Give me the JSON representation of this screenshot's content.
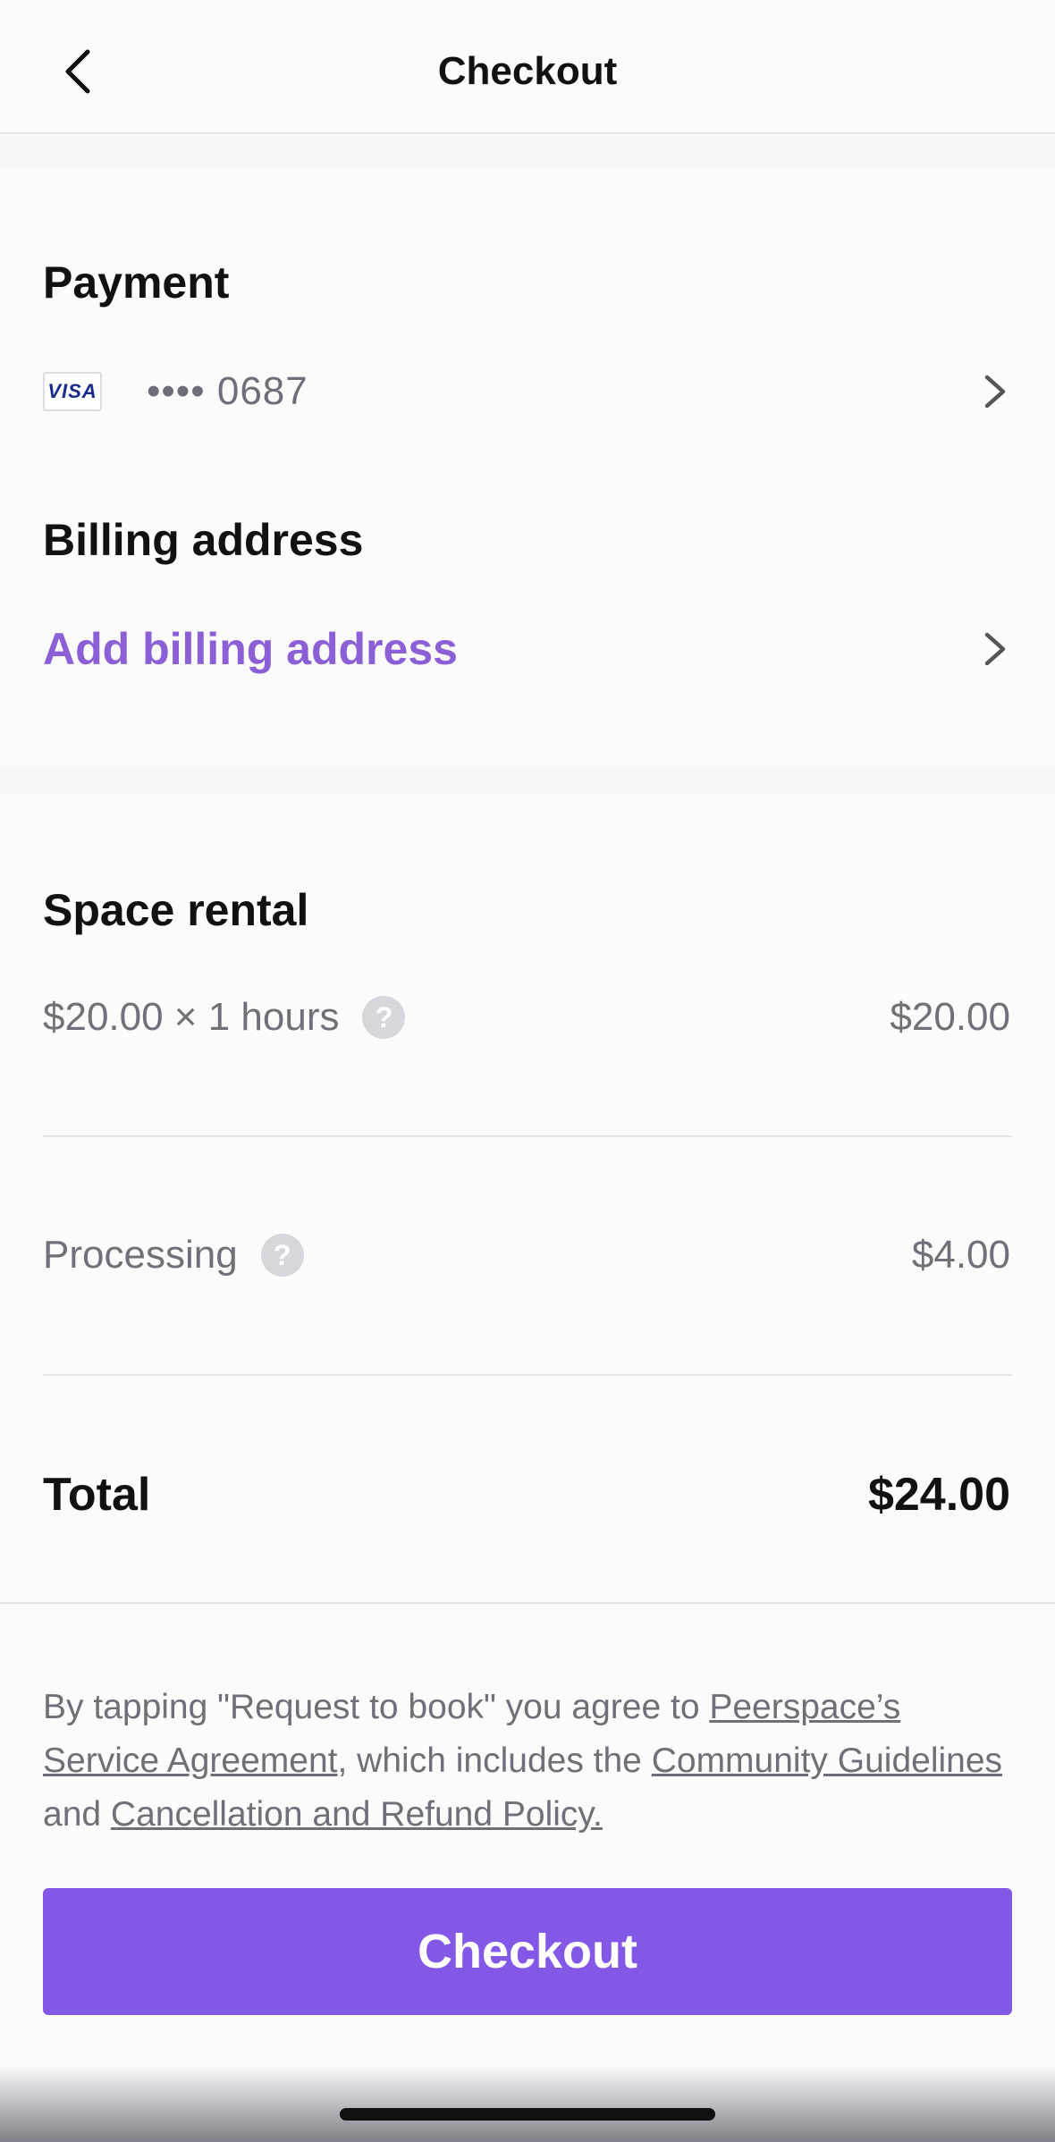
{
  "header": {
    "title": "Checkout",
    "back_icon": "chevron-left-icon"
  },
  "payment": {
    "section_title": "Payment",
    "card_brand": "VISA",
    "card_number": "•••• 0687"
  },
  "billing": {
    "section_title": "Billing address",
    "add_label": "Add billing address",
    "link_color": "#8b5fd6"
  },
  "pricing": {
    "section_title": "Space rental",
    "rental_label": "$20.00 × 1 hours",
    "rental_value": "$20.00",
    "processing_label": "Processing",
    "processing_value": "$4.00",
    "help_glyph": "?",
    "total_label": "Total",
    "total_value": "$24.00"
  },
  "legal": {
    "text_prefix": "By tapping \"Request to book\" you agree to ",
    "link_service_agreement": "Peerspace’s Service Agreement",
    "text_middle": ", which includes the ",
    "link_community": "Community Guidelines ",
    "text_and": "and ",
    "link_cancellation": "Cancellation and Refund Policy."
  },
  "checkout": {
    "button_label": "Checkout",
    "accent_color": "#8458e6"
  }
}
